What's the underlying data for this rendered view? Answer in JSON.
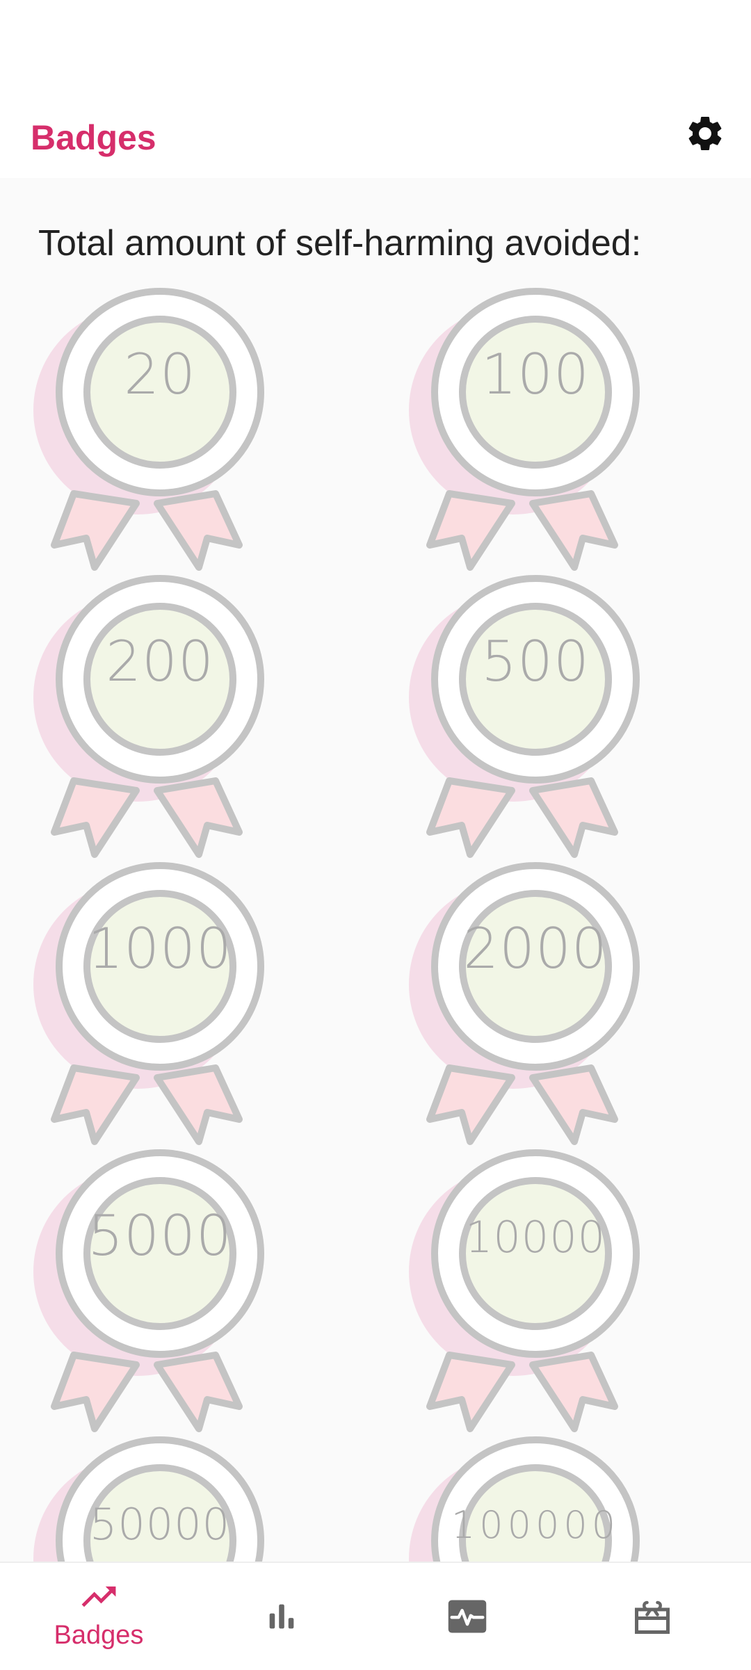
{
  "app": {
    "title": "Badges",
    "accent_color": "#d62e6b"
  },
  "header": {
    "settings_icon": "gear-icon"
  },
  "main": {
    "subtitle": "Total amount of self-harming avoided:",
    "badges": [
      {
        "value": "20"
      },
      {
        "value": "100"
      },
      {
        "value": "200"
      },
      {
        "value": "500"
      },
      {
        "value": "1000"
      },
      {
        "value": "2000"
      },
      {
        "value": "5000"
      },
      {
        "value": "10000"
      },
      {
        "value": "50000"
      },
      {
        "value": "100000"
      }
    ]
  },
  "bottom_nav": {
    "items": [
      {
        "label": "Badges",
        "icon": "trending-up-icon",
        "active": true
      },
      {
        "label": "",
        "icon": "bar-chart-icon",
        "active": false
      },
      {
        "label": "",
        "icon": "activity-icon",
        "active": false
      },
      {
        "label": "",
        "icon": "gift-card-icon",
        "active": false
      }
    ]
  }
}
